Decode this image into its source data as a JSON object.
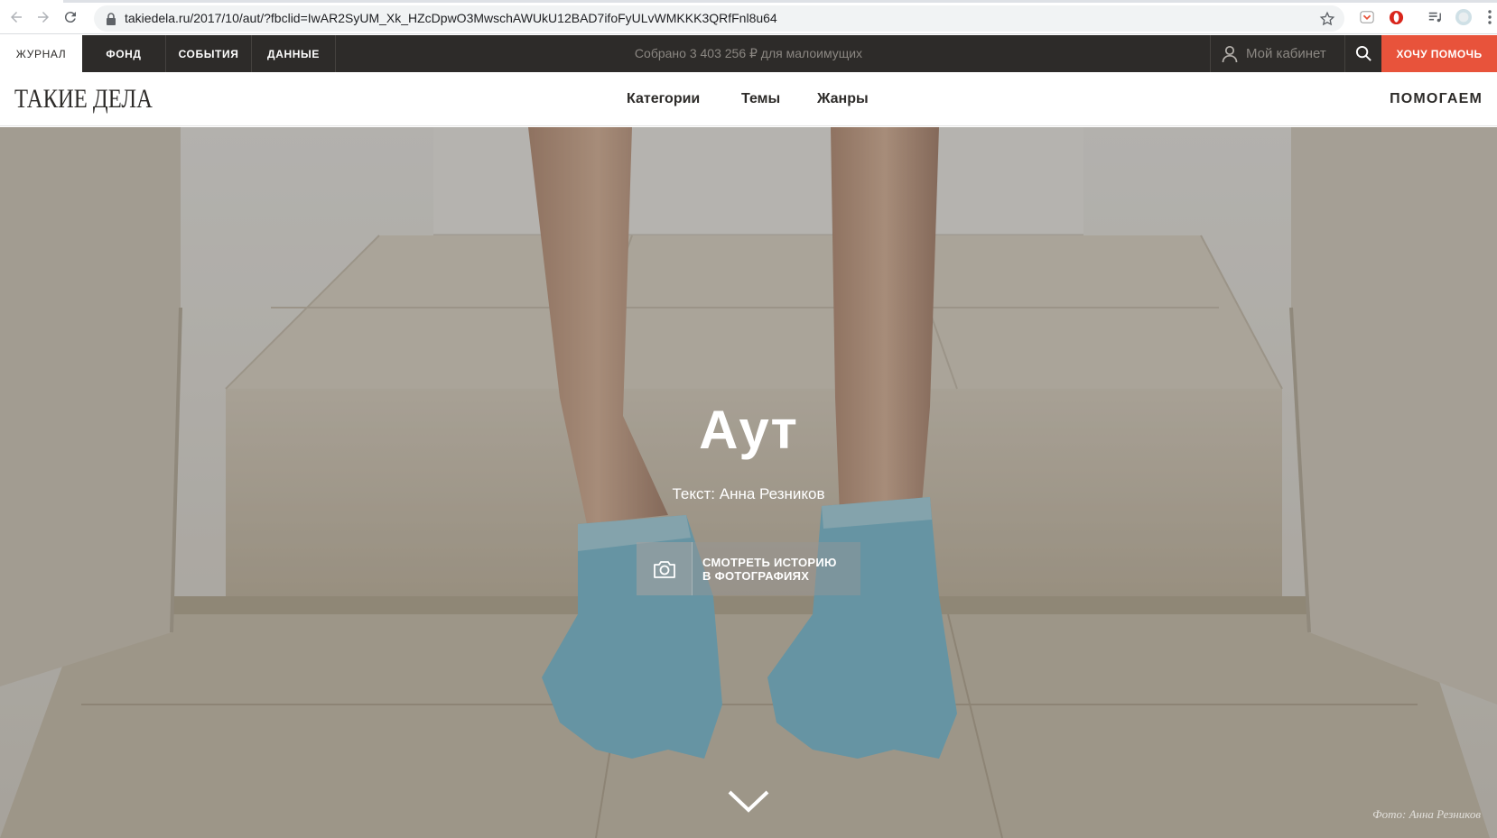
{
  "browser": {
    "url": "takiedela.ru/2017/10/aut/?fbclid=IwAR2SyUM_Xk_HZcDpwO3MwschAWUkU12BAD7ifoFyULvWMKKK3QRfFnl8u64",
    "icons": [
      "back-arrow-icon",
      "forward-arrow-icon",
      "reload-icon",
      "lock-icon",
      "star-icon",
      "pocket-extension-icon",
      "opera-extension-icon",
      "media-playlist-icon",
      "profile-avatar-icon",
      "more-menu-icon"
    ]
  },
  "topnav": {
    "tabs": [
      {
        "label": "ЖУРНАЛ",
        "active": true
      },
      {
        "label": "ФОНД",
        "active": false
      },
      {
        "label": "СОБЫТИЯ",
        "active": false
      },
      {
        "label": "ДАННЫЕ",
        "active": false
      }
    ],
    "collected": "Собрано 3 403 256 ₽ для малоимущих",
    "cabinet_label": "Мой кабинет",
    "help_label": "ХОЧУ ПОМОЧЬ",
    "accent_color": "#e8533b"
  },
  "header": {
    "logo": "ТАКИЕ ДЕЛА",
    "menu": [
      "Категории",
      "Темы",
      "Жанры"
    ],
    "helping": "ПОМОГАЕМ"
  },
  "hero": {
    "title": "Аут",
    "author": "Текст: Анна Резников",
    "photo_button_line1": "СМОТРЕТЬ ИСТОРИЮ",
    "photo_button_line2": "В ФОТОГРАФИЯХ",
    "credit": "Фото: Анна Резников"
  }
}
